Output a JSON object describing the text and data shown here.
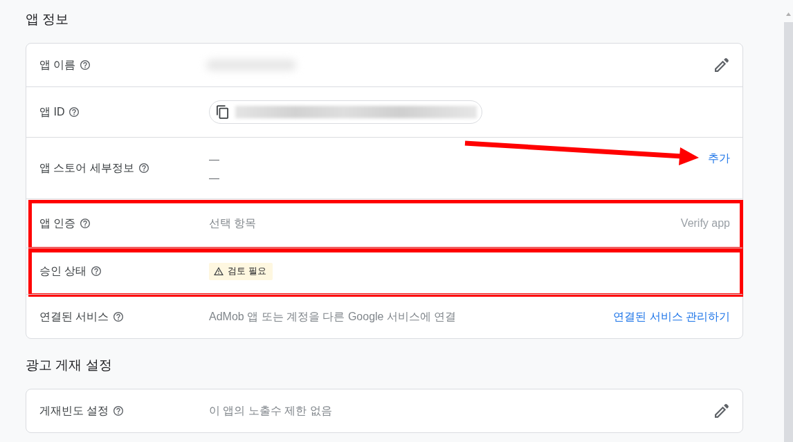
{
  "sections": [
    {
      "title": "앱 정보",
      "rows": [
        {
          "label": "앱 이름",
          "help_icon": true,
          "highlighted": false,
          "value": {
            "kind": "redacted"
          },
          "action": {
            "kind": "edit"
          }
        },
        {
          "label": "앱 ID",
          "help_icon": true,
          "highlighted": false,
          "value": {
            "kind": "copy_field"
          }
        },
        {
          "label": "앱 스토어 세부정보",
          "help_icon": true,
          "highlighted": false,
          "value": {
            "kind": "lines",
            "lines": [
              "—",
              "—"
            ]
          },
          "action": {
            "kind": "link",
            "label": "추가",
            "disabled": false,
            "pointed_by_arrow": true
          }
        },
        {
          "label": "앱 인증",
          "help_icon": true,
          "highlighted": true,
          "value": {
            "kind": "text",
            "text": "선택 항목"
          },
          "action": {
            "kind": "link",
            "label": "Verify app",
            "disabled": true,
            "pointed_by_arrow": false
          }
        },
        {
          "label": "승인 상태",
          "help_icon": true,
          "highlighted": true,
          "value": {
            "kind": "warning_badge",
            "text": "검토 필요"
          }
        },
        {
          "label": "연결된 서비스",
          "help_icon": true,
          "highlighted": false,
          "value": {
            "kind": "text",
            "text": "AdMob 앱 또는 계정을 다른 Google 서비스에 연결"
          },
          "action": {
            "kind": "link",
            "label": "연결된 서비스 관리하기",
            "disabled": false,
            "pointed_by_arrow": false
          }
        }
      ]
    },
    {
      "title": "광고 게재 설정",
      "rows": [
        {
          "label": "게재빈도 설정",
          "help_icon": true,
          "highlighted": false,
          "value": {
            "kind": "text",
            "text": "이 앱의 노출수 제한 없음"
          },
          "action": {
            "kind": "edit"
          }
        }
      ]
    }
  ]
}
